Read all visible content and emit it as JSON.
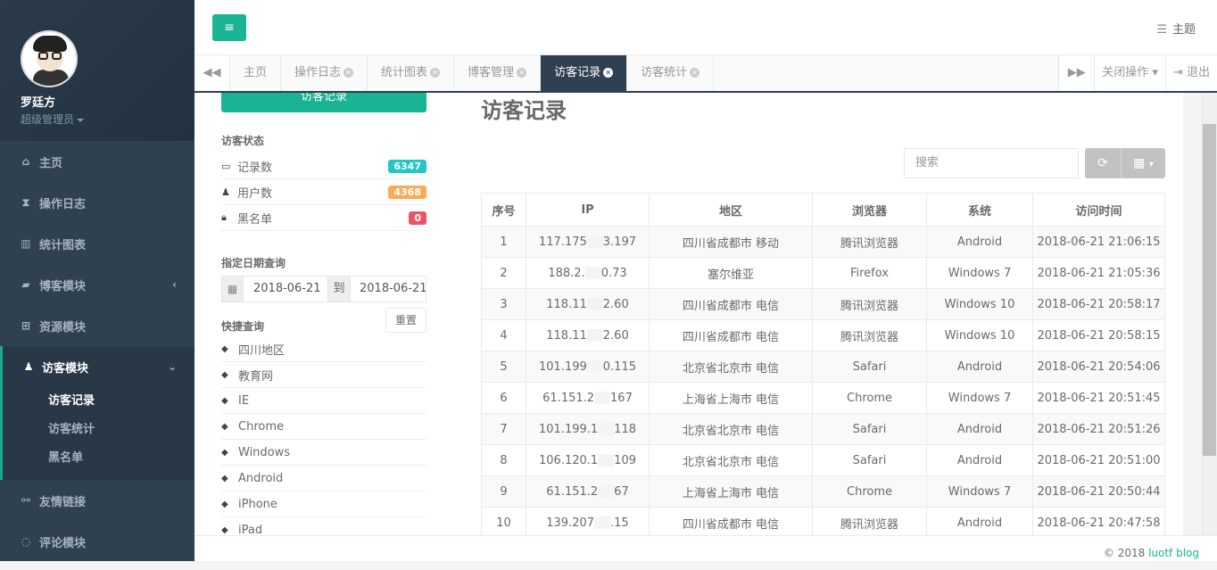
{
  "profile": {
    "name": "罗廷方",
    "role": "超级管理员"
  },
  "nav": [
    {
      "label": "主页",
      "icon": "home-icon",
      "glyph": "⌂"
    },
    {
      "label": "操作日志",
      "icon": "hourglass-icon",
      "glyph": "⧗"
    },
    {
      "label": "统计图表",
      "icon": "bar-chart-icon",
      "glyph": "▥"
    },
    {
      "label": "博客模块",
      "icon": "book-icon",
      "glyph": "▰",
      "arrow": "‹"
    },
    {
      "label": "资源模块",
      "icon": "grid-icon",
      "glyph": "⊞"
    }
  ],
  "nav_active": {
    "label": "访客模块",
    "icon": "user-icon",
    "glyph": "♟",
    "arrow": "⌄",
    "sub": [
      "访客记录",
      "访客统计",
      "黑名单"
    ]
  },
  "nav_after": [
    {
      "label": "友情链接",
      "icon": "link-icon",
      "glyph": "⚯"
    },
    {
      "label": "评论模块",
      "icon": "comment-icon",
      "glyph": "◌"
    }
  ],
  "topbar": {
    "theme_label": "主题"
  },
  "tabs": [
    {
      "label": "主页",
      "closable": false,
      "active": false
    },
    {
      "label": "操作日志",
      "closable": true,
      "active": false
    },
    {
      "label": "统计图表",
      "closable": true,
      "active": false
    },
    {
      "label": "博客管理",
      "closable": true,
      "active": false
    },
    {
      "label": "访客记录",
      "closable": true,
      "active": true
    },
    {
      "label": "访客统计",
      "closable": true,
      "active": false
    }
  ],
  "tab_ops": {
    "close_ops": "关闭操作",
    "logout": "退出"
  },
  "left": {
    "top_button": "访客记录",
    "status_title": "访客状态",
    "stats": [
      {
        "label": "记录数",
        "value": "6347",
        "color": "#23c6c8",
        "icon": "inbox-icon",
        "glyph": "▭"
      },
      {
        "label": "用户数",
        "value": "4368",
        "color": "#f8ac59",
        "icon": "user-icon",
        "glyph": "♟"
      },
      {
        "label": "黑名单",
        "value": "0",
        "color": "#ed5565",
        "icon": "lock-icon",
        "glyph": "🔒︎"
      }
    ],
    "date_title": "指定日期查询",
    "date_from": "2018-06-21",
    "date_to_label": "到",
    "date_to": "2018-06-21",
    "reset": "重置",
    "quick_title": "快捷查询",
    "quick": [
      "四川地区",
      "教育网",
      "IE",
      "Chrome",
      "Windows",
      "Android",
      "iPhone",
      "iPad"
    ]
  },
  "main": {
    "title": "访客记录",
    "search_placeholder": "搜索",
    "columns": [
      "序号",
      "IP",
      "地区",
      "浏览器",
      "系统",
      "访问时间"
    ],
    "rows": [
      [
        "1",
        "117.175",
        "3.197",
        "四川省成都市 移动",
        "腾讯浏览器",
        "Android",
        "2018-06-21 21:06:15"
      ],
      [
        "2",
        "188.2.",
        "0.73",
        "塞尔维亚",
        "Firefox",
        "Windows 7",
        "2018-06-21 21:05:36"
      ],
      [
        "3",
        "118.11",
        "2.60",
        "四川省成都市 电信",
        "腾讯浏览器",
        "Windows 10",
        "2018-06-21 20:58:17"
      ],
      [
        "4",
        "118.11",
        "2.60",
        "四川省成都市 电信",
        "腾讯浏览器",
        "Windows 10",
        "2018-06-21 20:58:15"
      ],
      [
        "5",
        "101.199",
        "0.115",
        "北京省北京市 电信",
        "Safari",
        "Android",
        "2018-06-21 20:54:06"
      ],
      [
        "6",
        "61.151.2",
        "167",
        "上海省上海市 电信",
        "Chrome",
        "Windows 7",
        "2018-06-21 20:51:45"
      ],
      [
        "7",
        "101.199.1",
        "118",
        "北京省北京市 电信",
        "Safari",
        "Android",
        "2018-06-21 20:51:26"
      ],
      [
        "8",
        "106.120.1",
        "109",
        "北京省北京市 电信",
        "Safari",
        "Android",
        "2018-06-21 20:51:00"
      ],
      [
        "9",
        "61.151.2",
        "67",
        "上海省上海市 电信",
        "Chrome",
        "Windows 7",
        "2018-06-21 20:50:44"
      ],
      [
        "10",
        "139.207",
        ".15",
        "四川省成都市 电信",
        "腾讯浏览器",
        "Android",
        "2018-06-21 20:47:58"
      ]
    ]
  },
  "footer": {
    "copyright": "© 2018 ",
    "link": "luotf blog"
  },
  "colors": {
    "sidebar": "#2f4050",
    "accent": "#1ab394"
  }
}
